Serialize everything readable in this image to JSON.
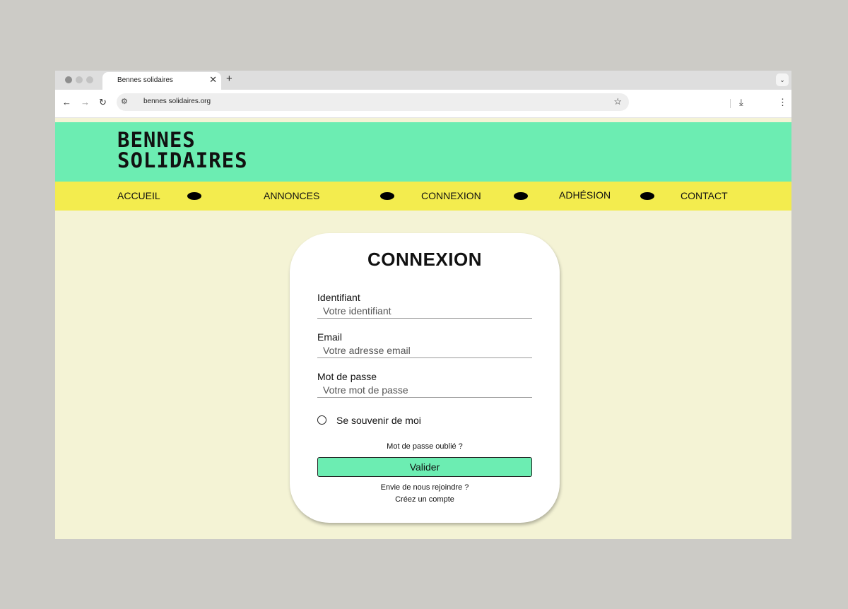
{
  "browser": {
    "tab_title": "Bennes solidaires",
    "tab_close": "✕",
    "new_tab": "+",
    "tab_menu": "⌄",
    "url": "bennes solidaires.org",
    "icons": {
      "back": "←",
      "forward": "→",
      "reload": "↻",
      "site_settings": "⚙",
      "bookmark": "☆",
      "download": "⤓",
      "menu": "⋮"
    }
  },
  "site": {
    "logo_line1": "BENNES",
    "logo_line2": "SOLIDAIRES",
    "nav": [
      "ACCUEIL",
      "ANNONCES",
      "CONNEXION",
      "ADHÉSION",
      "CONTACT"
    ],
    "colors": {
      "header": "#6cedb2",
      "nav": "#f3ec4e",
      "page": "#f4f3d5",
      "button": "#6cedb2"
    }
  },
  "login": {
    "title": "CONNEXION",
    "fields": [
      {
        "label": "Identifiant",
        "placeholder": "Votre identifiant"
      },
      {
        "label": "Email",
        "placeholder": "Votre adresse email"
      },
      {
        "label": "Mot de passe",
        "placeholder": "Votre mot de passe"
      }
    ],
    "remember": "Se souvenir de moi",
    "forgot": "Mot de passe oublié ?",
    "submit": "Valider",
    "join": "Envie de nous rejoindre ?",
    "create": "Créez un compte"
  }
}
